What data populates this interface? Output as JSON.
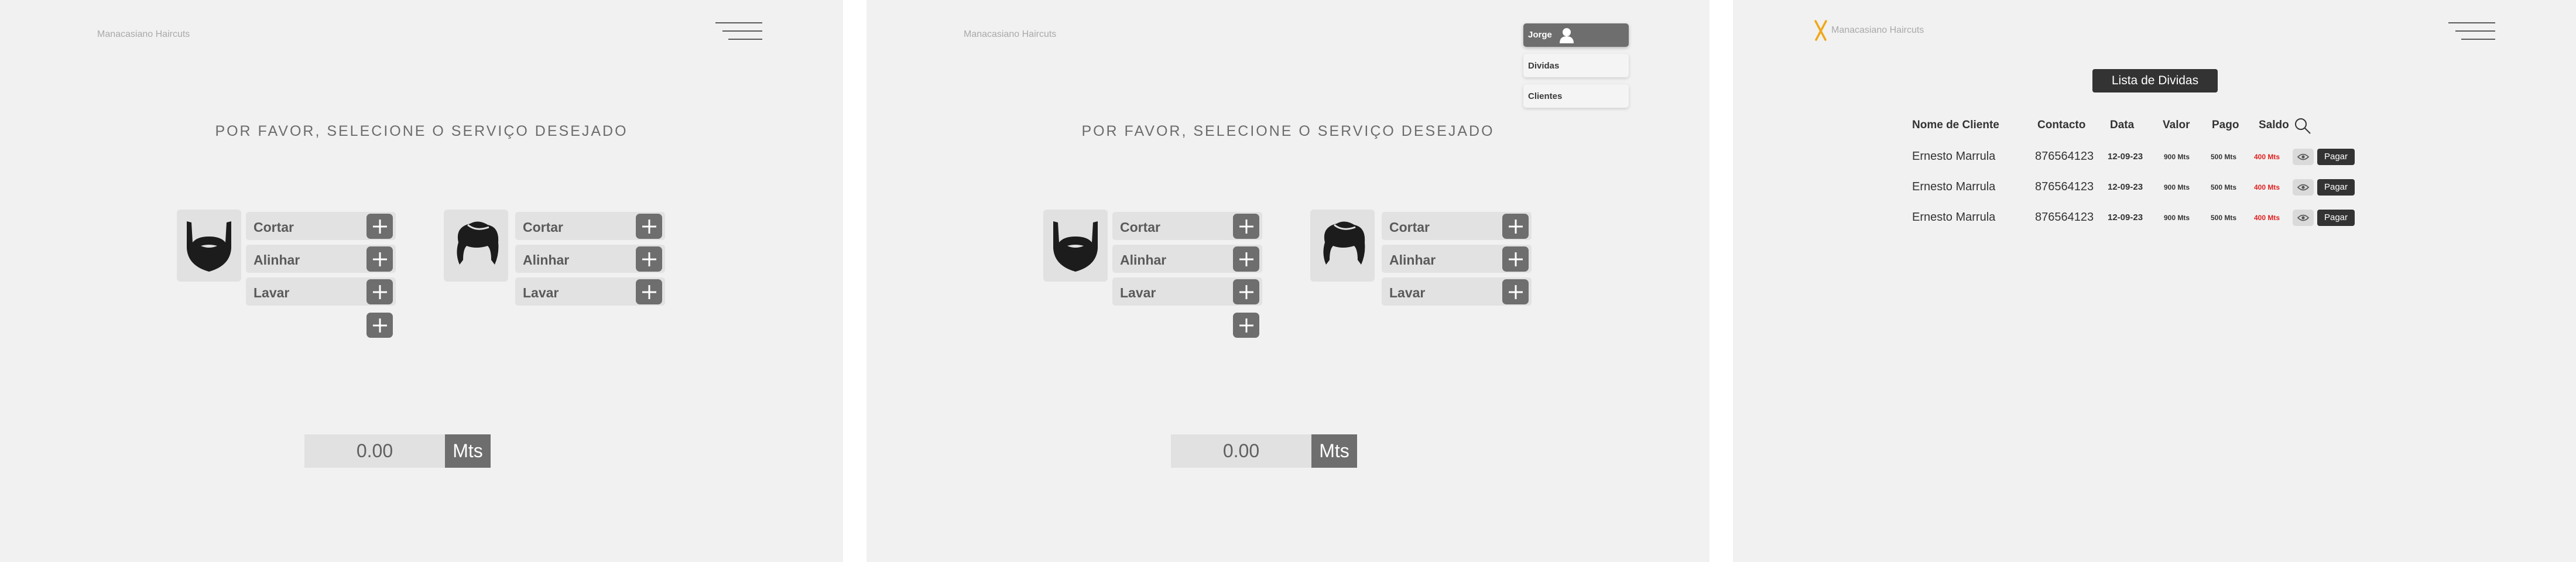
{
  "app": {
    "brand": "Manacasiano Haircuts"
  },
  "service_screen": {
    "prompt": "POR FAVOR, SELECIONE O SERVIÇO DESEJADO",
    "beard_services": [
      "Cortar",
      "Alinhar",
      "Lavar"
    ],
    "hair_services": [
      "Cortar",
      "Alinhar",
      "Lavar"
    ],
    "total": "0.00",
    "currency": "Mts"
  },
  "user_menu": {
    "user_name": "Jorge",
    "items": [
      "Dividas",
      "Clientes"
    ]
  },
  "debts": {
    "title": "Lista de Dividas",
    "headers": {
      "name": "Nome de Cliente",
      "contact": "Contacto",
      "date": "Data",
      "value": "Valor",
      "paid": "Pago",
      "balance": "Saldo"
    },
    "rows": [
      {
        "name": "Ernesto Marrula",
        "contact": "876564123",
        "date": "12-09-23",
        "value": "900 Mts",
        "paid": "500 Mts",
        "balance": "400 Mts",
        "pay_label": "Pagar"
      },
      {
        "name": "Ernesto Marrula",
        "contact": "876564123",
        "date": "12-09-23",
        "value": "900 Mts",
        "paid": "500 Mts",
        "balance": "400 Mts",
        "pay_label": "Pagar"
      },
      {
        "name": "Ernesto Marrula",
        "contact": "876564123",
        "date": "12-09-23",
        "value": "900 Mts",
        "paid": "500 Mts",
        "balance": "400 Mts",
        "pay_label": "Pagar"
      }
    ]
  },
  "colors": {
    "background": "#f1f1f1",
    "tile": "#e2e2e2",
    "button_gray": "#6e6e6e",
    "dark": "#333333",
    "balance_red": "#e02020",
    "logo_orange": "#f0a818"
  },
  "icons": [
    "menu-icon",
    "beard-icon",
    "hair-icon",
    "plus-icon",
    "user-icon",
    "scissors-icon",
    "search-icon",
    "eye-icon"
  ]
}
